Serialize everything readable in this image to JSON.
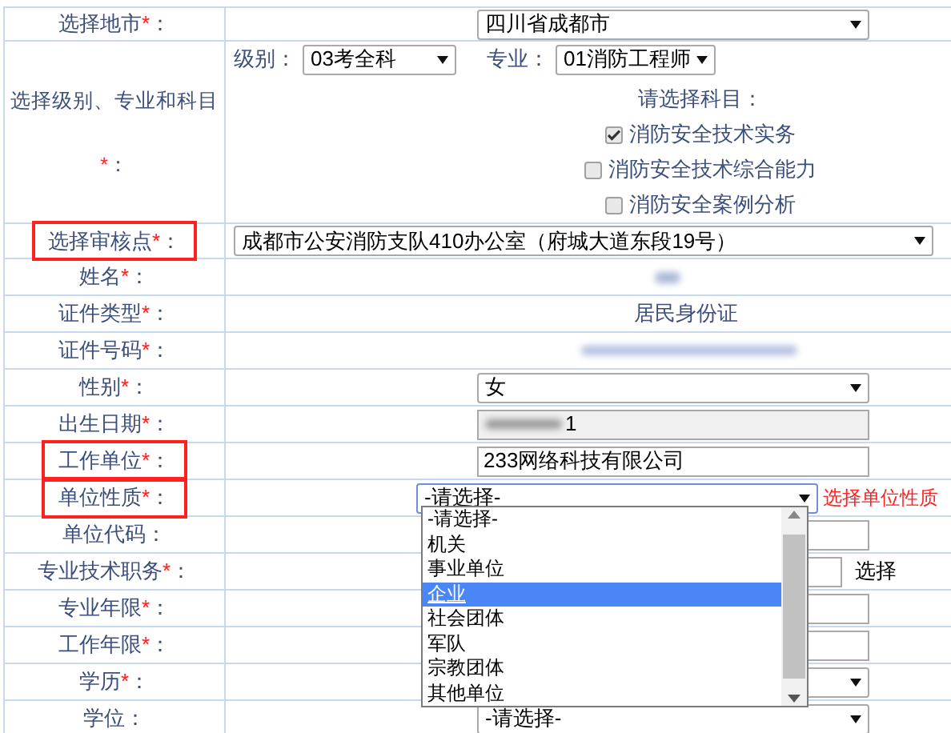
{
  "rows": [
    {
      "kind": "select",
      "label": "选择地市",
      "star": "*",
      "colon": "：",
      "highlighted": false,
      "value": "四川省成都市"
    },
    {
      "kind": "subjects",
      "label": "选择级别、专业和科目",
      "star": "*",
      "colon": "：",
      "highlighted": false,
      "level_label": "级别：",
      "level_value": "03考全科",
      "major_label": "专业：",
      "major_value": "01消防工程师",
      "prompt": "请选择科目：",
      "subjects": [
        {
          "label": "消防安全技术实务",
          "checked": true
        },
        {
          "label": "消防安全技术综合能力",
          "checked": false
        },
        {
          "label": "消防安全案例分析",
          "checked": false
        }
      ]
    },
    {
      "kind": "wide_select",
      "label": "选择审核点",
      "star": "*",
      "colon": "：",
      "highlighted": true,
      "value": "成都市公安消防支队410办公室（府城大道东段19号）"
    },
    {
      "kind": "blurred",
      "label": "姓名",
      "star": "*",
      "colon": "：",
      "highlighted": false
    },
    {
      "kind": "text",
      "label": "证件类型",
      "star": "*",
      "colon": "：",
      "highlighted": false,
      "value": "居民身份证"
    },
    {
      "kind": "blurred_long",
      "label": "证件号码",
      "star": "*",
      "colon": "：",
      "highlighted": false
    },
    {
      "kind": "select",
      "label": "性别",
      "star": "*",
      "colon": "：",
      "highlighted": false,
      "value": "女"
    },
    {
      "kind": "blurred_input",
      "label": "出生日期",
      "star": "*",
      "colon": "：",
      "highlighted": false,
      "value": "1"
    },
    {
      "kind": "input",
      "label": "工作单位",
      "star": "*",
      "colon": "：",
      "highlighted": true,
      "value": "233网络科技有限公司"
    },
    {
      "kind": "open_select",
      "label": "单位性质",
      "star": "*",
      "colon": "：",
      "highlighted": true,
      "value": "-请选择-",
      "hint": "选择单位性质"
    },
    {
      "kind": "input",
      "label": "单位代码",
      "colon": "：",
      "highlighted": false
    },
    {
      "kind": "input_button",
      "label": "专业技术职务",
      "star": "*",
      "colon": "：",
      "highlighted": false,
      "button": "选择"
    },
    {
      "kind": "input",
      "label": "专业年限",
      "star": "*",
      "colon": "：",
      "highlighted": false
    },
    {
      "kind": "input",
      "label": "工作年限",
      "star": "*",
      "colon": "：",
      "highlighted": false
    },
    {
      "kind": "select",
      "label": "学历",
      "star": "*",
      "colon": "：",
      "highlighted": false
    },
    {
      "kind": "select",
      "label": "学位",
      "colon": "：",
      "highlighted": false,
      "value": "-请选择-"
    }
  ],
  "dropdown": {
    "options": [
      {
        "label": "-请选择-",
        "selected": false
      },
      {
        "label": "机关",
        "selected": false
      },
      {
        "label": "事业单位",
        "selected": false
      },
      {
        "label": "企业",
        "selected": true
      },
      {
        "label": "社会团体",
        "selected": false
      },
      {
        "label": "军队",
        "selected": false
      },
      {
        "label": "宗教团体",
        "selected": false
      },
      {
        "label": "其他单位",
        "selected": false
      }
    ]
  }
}
